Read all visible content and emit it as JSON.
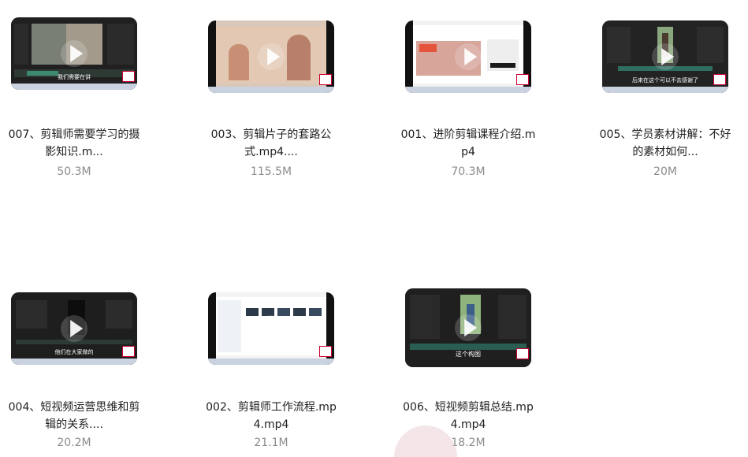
{
  "files": [
    {
      "title_line1": "007、剪辑师需要学习的摄",
      "title_line2": "影知识.m...",
      "size": "50.3M",
      "caption": "我们需要在讲"
    },
    {
      "title_line1": "003、剪辑片子的套路公",
      "title_line2": "式.mp4....",
      "size": "115.5M",
      "caption": ""
    },
    {
      "title_line1": "001、进阶剪辑课程介绍.m",
      "title_line2": "p4",
      "size": "70.3M",
      "caption": ""
    },
    {
      "title_line1": "005、学员素材讲解：不好",
      "title_line2": "的素材如何...",
      "size": "20M",
      "caption": "后来在这个可以不去感谢了"
    },
    {
      "title_line1": "004、短视频运营思维和剪",
      "title_line2": "辑的关系....",
      "size": "20.2M",
      "caption": "他们在大家做的"
    },
    {
      "title_line1": "002、剪辑师工作流程.mp",
      "title_line2": "4.mp4",
      "size": "21.1M",
      "caption": ""
    },
    {
      "title_line1": "006、短视频剪辑总结.mp",
      "title_line2": "4.mp4",
      "size": "18.2M",
      "caption": "这个构图"
    }
  ]
}
